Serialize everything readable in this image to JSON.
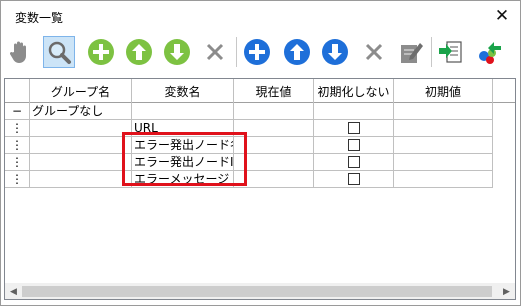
{
  "window": {
    "title": "変数一覧",
    "close_glyph": "✕"
  },
  "toolbar": {
    "buttons": [
      {
        "name": "hand-icon"
      },
      {
        "name": "search-icon"
      },
      {
        "name": "add-green-icon"
      },
      {
        "name": "arrow-up-green-icon"
      },
      {
        "name": "arrow-down-green-icon"
      },
      {
        "name": "delete-gray-icon"
      },
      {
        "name": "add-blue-icon"
      },
      {
        "name": "arrow-up-blue-icon"
      },
      {
        "name": "arrow-down-blue-icon"
      },
      {
        "name": "delete-gray-icon-2"
      },
      {
        "name": "edit-icon"
      },
      {
        "name": "import-icon"
      },
      {
        "name": "export-icon"
      }
    ]
  },
  "grid": {
    "columns": [
      "グループ名",
      "変数名",
      "現在値",
      "初期化しない",
      "初期値"
    ],
    "rows": [
      {
        "marker": "−",
        "group": "グループなし",
        "var": "",
        "value": "",
        "no_init_checkbox": false,
        "init": ""
      },
      {
        "marker": "⋮",
        "group": "",
        "var": "URL",
        "value": "",
        "no_init_checkbox": true,
        "init": ""
      },
      {
        "marker": "⋮",
        "group": "",
        "var": "エラー発出ノード名",
        "value": "",
        "no_init_checkbox": true,
        "init": ""
      },
      {
        "marker": "⋮",
        "group": "",
        "var": "エラー発出ノードID",
        "value": "",
        "no_init_checkbox": true,
        "init": ""
      },
      {
        "marker": "⋮",
        "group": "",
        "var": "エラーメッセージ",
        "value": "",
        "no_init_checkbox": true,
        "init": ""
      }
    ]
  },
  "colors": {
    "highlight": "#e0111b",
    "green": "#7dc242",
    "blue": "#1e6fd9",
    "gray": "#8c8c8c"
  }
}
